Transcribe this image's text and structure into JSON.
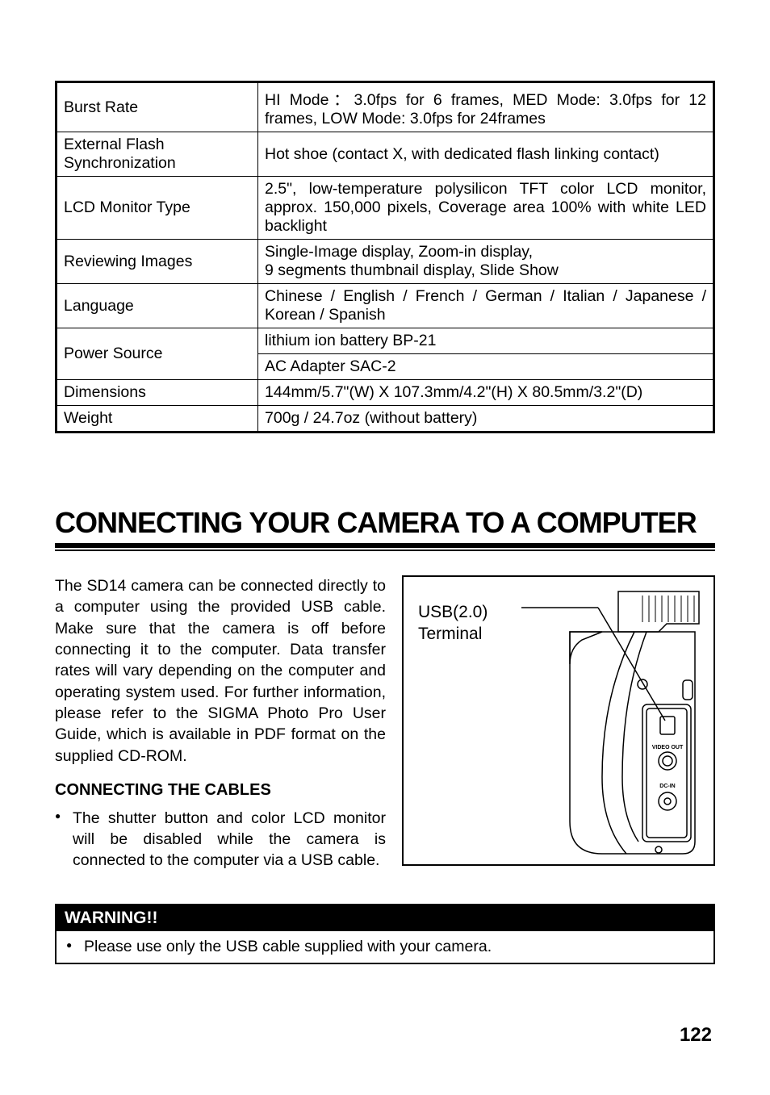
{
  "spec_table": {
    "rows": [
      {
        "label": "Burst Rate",
        "value": "HI Mode：3.0fps for 6 frames,  MED Mode: 3.0fps for 12 frames,  LOW Mode: 3.0fps for 24frames"
      },
      {
        "label": "External Flash Synchronization",
        "value": "Hot shoe (contact X, with dedicated flash linking contact)",
        "small": true
      },
      {
        "label": "LCD Monitor Type",
        "value": "2.5\", low-temperature polysilicon TFT color LCD monitor, approx. 150,000 pixels,  Coverage area 100% with white LED backlight"
      },
      {
        "label": "Reviewing Images",
        "value": "Single-Image display, Zoom-in display,\n9 segments thumbnail display, Slide Show"
      },
      {
        "label": "Language",
        "value": "Chinese / English / French / German / Italian / Japanese / Korean / Spanish"
      },
      {
        "label": "Power Source",
        "value": "lithium ion battery BP-21",
        "rowspan_label": 2
      },
      {
        "label": "",
        "value": "AC Adapter SAC-2",
        "skip_label": true
      },
      {
        "label": "Dimensions",
        "value": "144mm/5.7\"(W) X 107.3mm/4.2\"(H) X 80.5mm/3.2\"(D)"
      },
      {
        "label": "Weight",
        "value": "700g / 24.7oz (without battery)"
      }
    ]
  },
  "section_title": "CONNECTING YOUR CAMERA TO A COMPUTER",
  "body_paragraph": "The SD14 camera can be connected directly to a computer using the provided USB cable. Make sure that the camera is off before connecting it to the computer. Data transfer rates will vary depending on the computer and operating system used. For further information, please refer to the SIGMA Photo Pro User Guide, which is available in PDF format on the supplied CD-ROM.",
  "sub_heading": "CONNECTING THE CABLES",
  "bullet_1": "The shutter button and color LCD monitor will be disabled while the camera is connected to the computer via a USB cable.",
  "diagram_label_line1": "USB(2.0)",
  "diagram_label_line2": "Terminal",
  "port_label_1": "VIDEO OUT",
  "port_label_2": "DC-IN",
  "warning_header": "WARNING!!",
  "warning_bullet": "Please use only the USB cable supplied with your camera.",
  "page_number": "122"
}
